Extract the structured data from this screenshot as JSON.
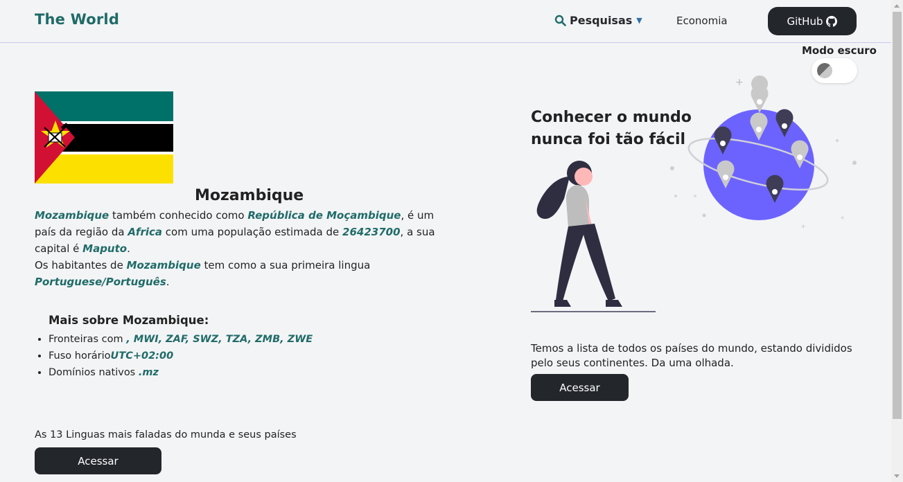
{
  "header": {
    "brand": "The World",
    "nav_search_label": "Pesquisas",
    "nav_economy_label": "Economia",
    "github_label": "GitHub"
  },
  "dark_mode": {
    "label": "Modo escuro",
    "enabled": false
  },
  "country": {
    "name": "Mozambique",
    "flag_colors": {
      "green": "#007168",
      "black": "#000000",
      "yellow": "#FCE100",
      "red": "#D21034",
      "white": "#FFFFFF"
    },
    "description": {
      "name": "Mozambique",
      "t1": " também conhecido como ",
      "official_name": "República de Moçambique",
      "t2": ", é um país da região da ",
      "region": "Africa",
      "t3": " com uma população estimada de ",
      "population": "26423700",
      "t4": ", a sua capital é ",
      "capital": "Maputo",
      "t5": ".",
      "t6": "Os habitantes de ",
      "name2": "Mozambique",
      "t7": " tem como a sua primeira lingua ",
      "language": "Portuguese/Português",
      "t8": "."
    },
    "more": {
      "title": "Mais sobre Mozambique:",
      "borders_label": "Fronteiras com",
      "borders_value": ", MWI, ZAF, SWZ, TZA, ZMB, ZWE",
      "timezone_label": "Fuso horário",
      "timezone_value": "UTC+02:00",
      "domain_label": "Domínios nativos",
      "domain_value": ".mz"
    }
  },
  "languages": {
    "text": "As 13 Linguas mais faladas do munda e seus países",
    "button": "Acessar"
  },
  "hero": {
    "title": "Conhecer o mundo nunca foi tão fácil",
    "text": "Temos a lista de todos os países do mundo, estando divididos pelo seus continentes. Da uma olhada.",
    "button": "Acessar",
    "globe_color": "#6c63ff"
  }
}
